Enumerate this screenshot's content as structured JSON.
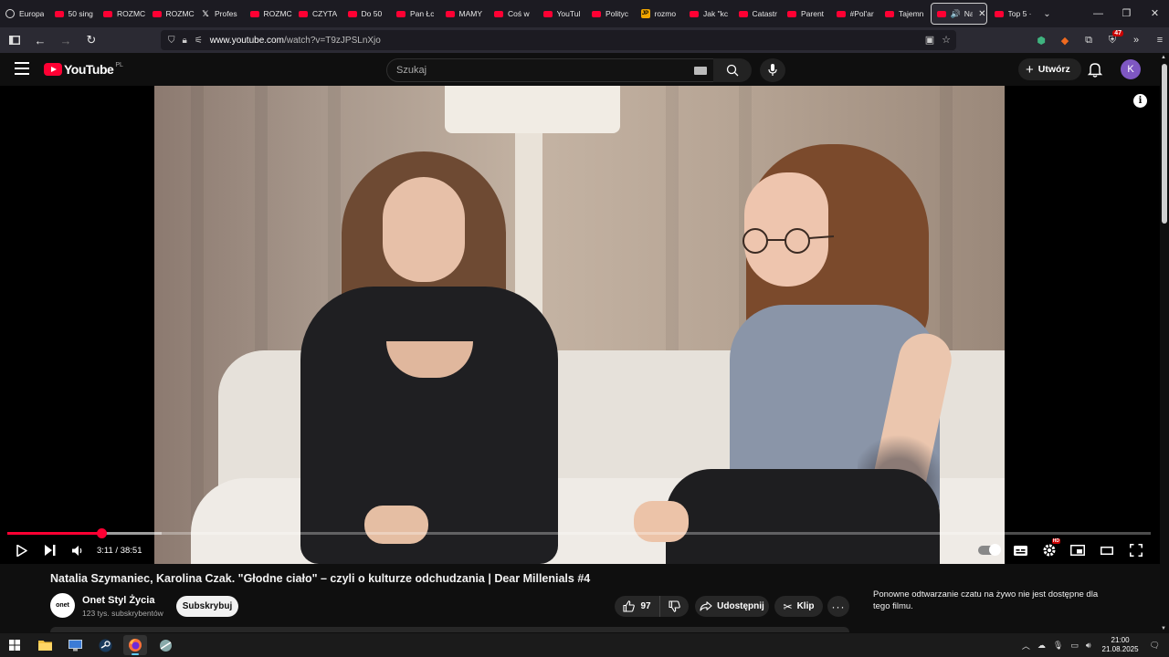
{
  "browser": {
    "tabs": [
      {
        "label": "Europa",
        "icon": "globe-icon"
      },
      {
        "label": "50 sing",
        "icon": "youtube-icon"
      },
      {
        "label": "ROZMC",
        "icon": "youtube-icon"
      },
      {
        "label": "ROZMC",
        "icon": "youtube-icon"
      },
      {
        "label": "Profes",
        "icon": "x-icon"
      },
      {
        "label": "ROZMC",
        "icon": "youtube-icon"
      },
      {
        "label": "CZYTA",
        "icon": "youtube-icon"
      },
      {
        "label": "Do 50",
        "icon": "youtube-icon"
      },
      {
        "label": "Pan Łc",
        "icon": "youtube-icon"
      },
      {
        "label": "MAMY",
        "icon": "youtube-icon"
      },
      {
        "label": "Coś w",
        "icon": "youtube-icon"
      },
      {
        "label": "YouTul",
        "icon": "youtube-icon"
      },
      {
        "label": "Polityc",
        "icon": "youtube-icon"
      },
      {
        "label": "rozmo",
        "icon": "wp-icon"
      },
      {
        "label": "Jak \"kc",
        "icon": "youtube-icon"
      },
      {
        "label": "Catastr",
        "icon": "youtube-icon"
      },
      {
        "label": "Parent",
        "icon": "youtube-icon"
      },
      {
        "label": "#Pol'ar",
        "icon": "youtube-icon"
      },
      {
        "label": "Tajemn",
        "icon": "youtube-icon"
      }
    ],
    "active_tab": {
      "label": "Nat"
    },
    "after_tab": {
      "label": "Top 5 ·"
    },
    "url_host": "www.youtube.com",
    "url_path": "/watch?v=T9zJPSLnXjo",
    "ext_badge": "47"
  },
  "youtube": {
    "logo_text": "YouTube",
    "country_code": "PL",
    "search_placeholder": "Szukaj",
    "create_label": "Utwórz",
    "avatar_letter": "K"
  },
  "player": {
    "current_time": "3:11",
    "duration": "38:51",
    "played_fraction": 0.082,
    "buffered_fraction": 0.135,
    "hd_badge": "HD"
  },
  "video": {
    "title": "Natalia Szymaniec, Karolina Czak. \"Głodne ciało\" – czyli o kulturze odchudzania | Dear Millenials #4",
    "channel_logo_text": "onet",
    "channel_name": "Onet Styl Życia",
    "channel_subs": "123 tys. subskrybentów",
    "subscribe_label": "Subskrybuj",
    "likes": "97",
    "share_label": "Udostępnij",
    "clip_label": "Klip",
    "chat_note": "Ponowne odtwarzanie czatu na żywo nie jest dostępne dla tego filmu."
  },
  "taskbar": {
    "time": "21:00",
    "date": "21.08.2025"
  },
  "colors": {
    "accent_red": "#ff0033",
    "background": "#0f0f0f",
    "button_bg": "#272727"
  }
}
